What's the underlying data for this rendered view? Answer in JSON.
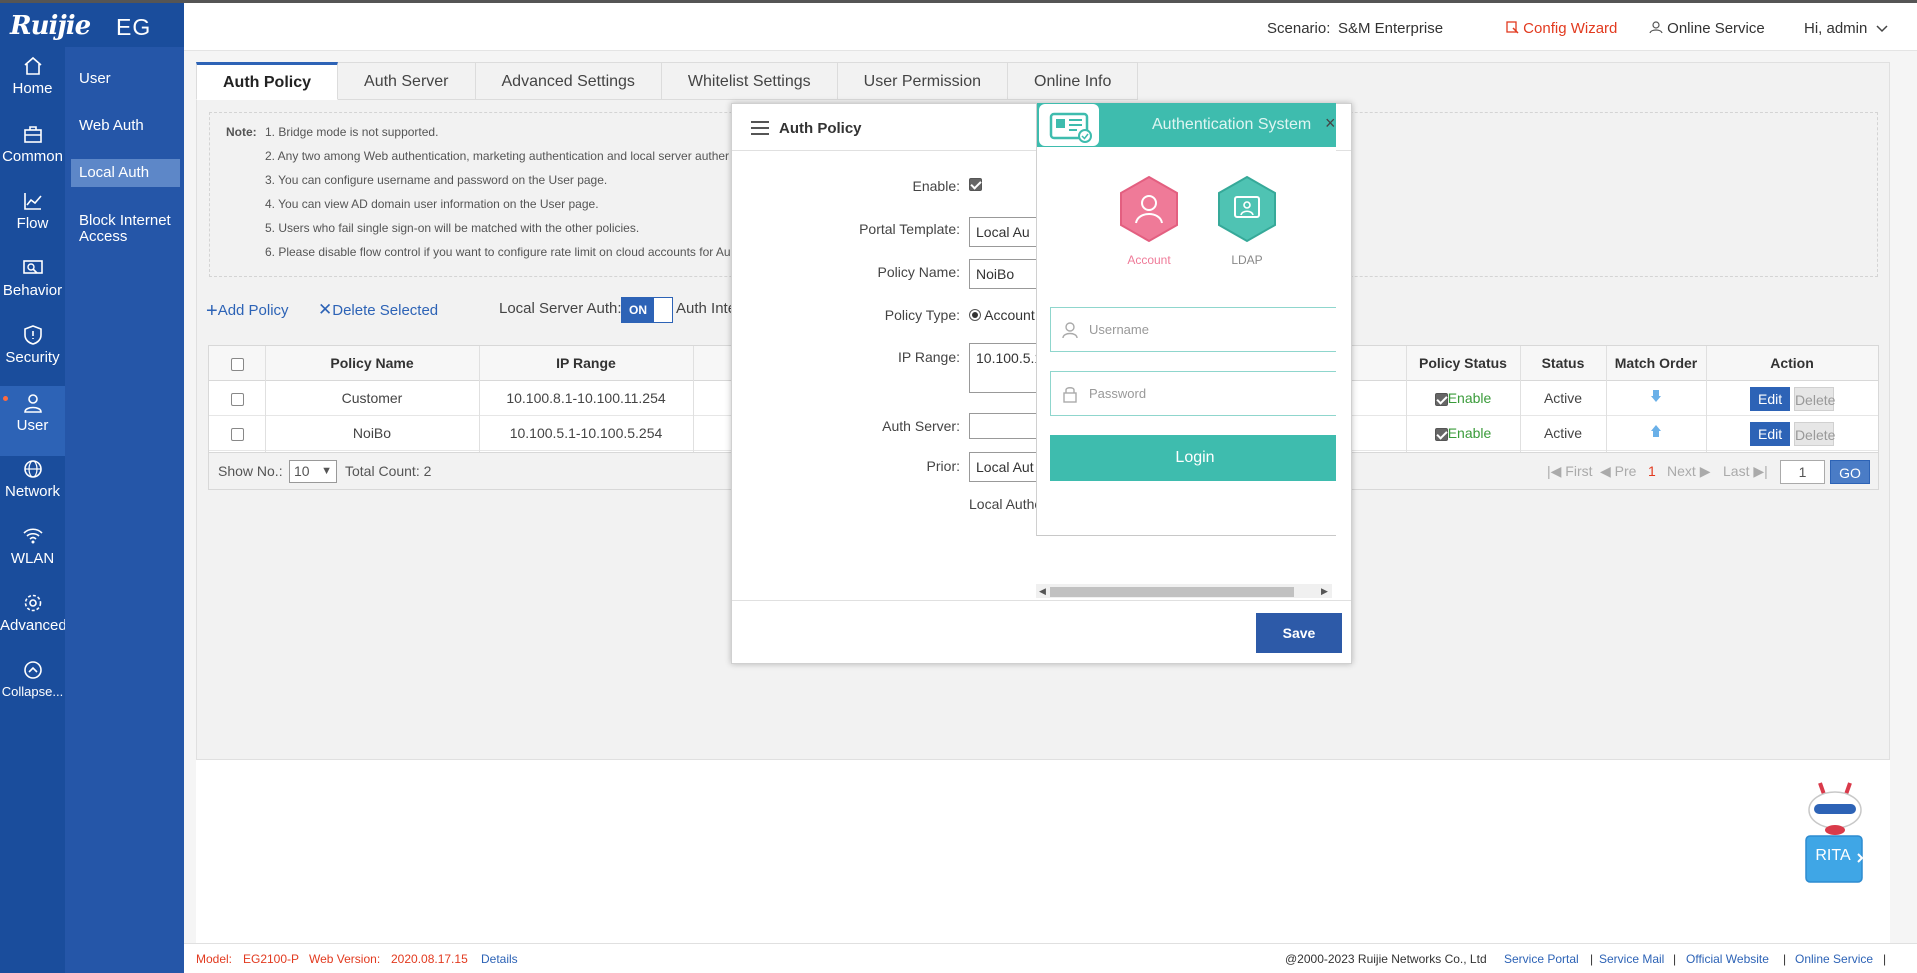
{
  "brand": {
    "logo": "Ruijie",
    "product": "EG"
  },
  "nav": [
    {
      "id": "home",
      "label": "Home"
    },
    {
      "id": "common",
      "label": "Common"
    },
    {
      "id": "flow",
      "label": "Flow"
    },
    {
      "id": "behavior",
      "label": "Behavior"
    },
    {
      "id": "security",
      "label": "Security"
    },
    {
      "id": "user",
      "label": "User"
    },
    {
      "id": "network",
      "label": "Network"
    },
    {
      "id": "wlan",
      "label": "WLAN"
    },
    {
      "id": "advanced",
      "label": "Advanced"
    },
    {
      "id": "collapse",
      "label": "Collapse..."
    }
  ],
  "subnav": [
    "User",
    "Web Auth",
    "Local Auth",
    "Block Internet",
    "Access"
  ],
  "header": {
    "scenario_label": "Scenario:",
    "scenario_value": "S&M Enterprise",
    "config_wizard": "Config Wizard",
    "online_service": "Online Service",
    "user": "Hi, admin"
  },
  "tabs": [
    "Auth Policy",
    "Auth Server",
    "Advanced Settings",
    "Whitelist Settings",
    "User Permission",
    "Online Info"
  ],
  "notes": {
    "label": "Note:",
    "lines": [
      "1. Bridge mode is not supported.",
      "2. Any two among Web authentication, marketing authentication and local server auther",
      "3. You can configure username and password on the User page.",
      "4. You can view AD domain user information on the User page.",
      "5. Users who fail single sign-on will be matched with the other policies.",
      "6. Please disable flow control if you want to configure rate limit on cloud accounts for Au"
    ]
  },
  "actions": {
    "add": "Add Policy",
    "delete": "Delete Selected",
    "local_server_auth": "Local Server Auth:",
    "switch_on": "ON",
    "auth_inte": "Auth Inte"
  },
  "table": {
    "headers": {
      "policy_name": "Policy Name",
      "ip_range": "IP Range",
      "policy_status": "Policy Status",
      "status": "Status",
      "match_order": "Match Order",
      "action": "Action"
    },
    "rows": [
      {
        "name": "Customer",
        "ip": "10.100.8.1-10.100.11.254",
        "policy_status": "Enable",
        "status": "Active",
        "edit": "Edit",
        "delete": "Delete"
      },
      {
        "name": "NoiBo",
        "ip": "10.100.5.1-10.100.5.254",
        "policy_status": "Enable",
        "status": "Active",
        "edit": "Edit",
        "delete": "Delete"
      }
    ]
  },
  "pager": {
    "show_no": "Show No.:",
    "page_size": "10",
    "total": "Total Count: 2",
    "first": "First",
    "pre": "Pre",
    "current": "1",
    "next": "Next",
    "last": "Last",
    "input": "1",
    "go": "GO"
  },
  "modal": {
    "title": "Auth Policy",
    "enable_label": "Enable:",
    "portal_template_label": "Portal Template:",
    "portal_template_value": "Local Au",
    "policy_name_label": "Policy Name:",
    "policy_name_value": "NoiBo",
    "policy_type_label": "Policy Type:",
    "policy_type_value": "Account",
    "ip_range_label": "IP Range:",
    "ip_range_value": "10.100.5.1",
    "auth_server_label": "Auth Server:",
    "auth_server_value": "",
    "prior_label": "Prior:",
    "prior_value": "Local Aut",
    "local_auth_text": "Local Authe",
    "save": "Save"
  },
  "preview": {
    "title": "Authentication System",
    "account": "Account",
    "ldap": "LDAP",
    "username_placeholder": "Username",
    "password_placeholder": "Password",
    "login": "Login"
  },
  "footer": {
    "model_label": "Model:",
    "model_value": "EG2100-P",
    "web_version_label": "Web Version:",
    "web_version_value": "2020.08.17.15",
    "details": "Details",
    "copyright": "@2000-2023 Ruijie Networks Co., Ltd",
    "links": [
      "Service Portal",
      "Service Mail",
      "Official Website",
      "Online Service"
    ]
  },
  "rita": "RITA",
  "colors": {
    "nav": "#1a4d9c",
    "accent": "#2d63b6",
    "teal": "#3ebcae",
    "red": "#e23a1f"
  }
}
